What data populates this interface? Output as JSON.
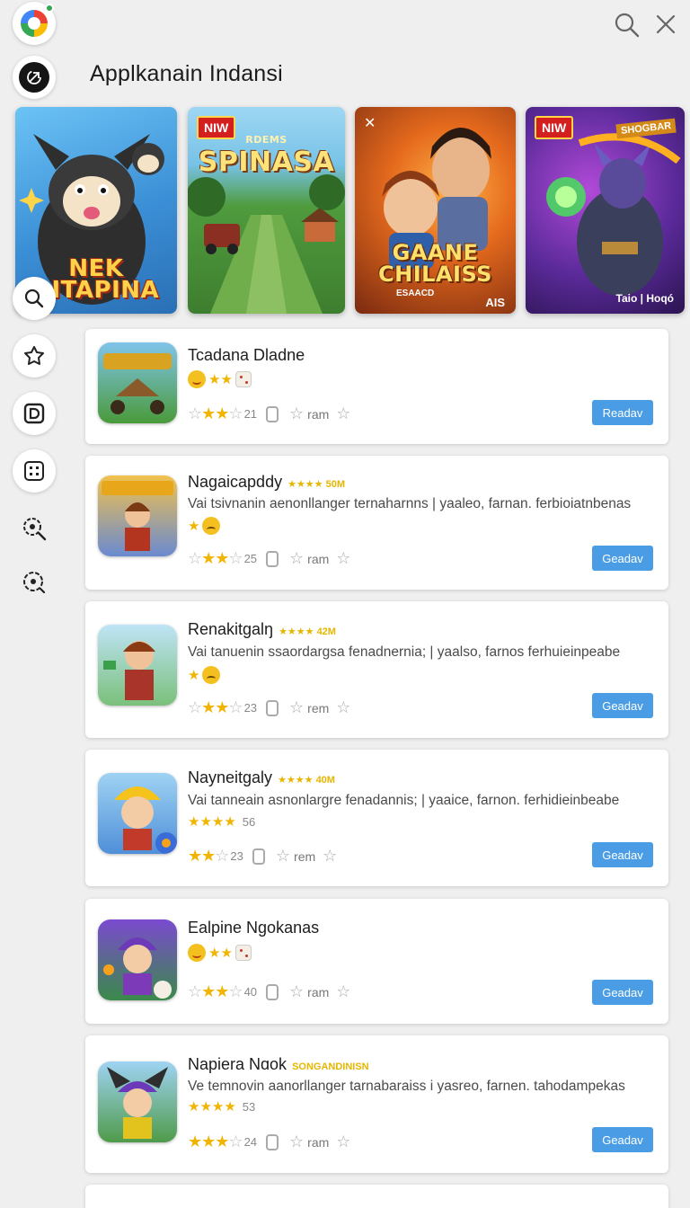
{
  "header": {
    "title": "Applkanain Indansi",
    "logo_icon": "chrome-style-logo-icon",
    "search_icon": "search-icon",
    "close_icon": "close-icon"
  },
  "rail": [
    "back-arrow-icon",
    "search-icon",
    "puzzle-star-icon",
    "square-d-icon",
    "grid-icon",
    "gear-search-icon",
    "gear-icon"
  ],
  "banners": [
    {
      "title": "NEK AITAPINA",
      "badge": "",
      "corner": "",
      "bg": "#4a9fe0"
    },
    {
      "title": "SPINASA",
      "badge": "NIW",
      "subtitle": "RDEMS",
      "corner": "",
      "bg": "#3e8a3a"
    },
    {
      "title": "GAANE CHILAISS",
      "badge": "",
      "corner": "AIS",
      "small": "ESAACD",
      "bg": "#c4561c"
    },
    {
      "title": "",
      "badge": "NIW",
      "corner": "Taio | Hoqó",
      "ribbon": "SHOGBAR",
      "bg": "#4b2a8f"
    }
  ],
  "apps": [
    {
      "name": "Tcadana Dladne",
      "tag": "",
      "desc": "",
      "mini": "emoji-happy-stars-dice",
      "stars_count": "21",
      "ram": "ram",
      "button": "Readav"
    },
    {
      "name": "Nagaicapddy",
      "tag": "★★★★ 50M",
      "desc": "Vai tsivnanin aenonllanger ternaharnns | yaaleo, farnan. ferbioiatnbenas",
      "mini": "star-sad",
      "stars_count": "25",
      "ram": "ram",
      "button": "Geadav"
    },
    {
      "name": "Renakitgalŋ",
      "tag": "★★★★ 42M",
      "desc": "Vai tanuenin ssaordargsa fenadnernia; | yaalso, farnos ferhuieinpeabe",
      "mini": "star-sad",
      "stars_count": "23",
      "ram": "rem",
      "button": "Geadav"
    },
    {
      "name": "Nayneitgaly",
      "tag": "★★★★ 40M",
      "desc": "Vai tanneain asnonlargre fenadannis; | yaaice, farnon. ferhidieinbeabe",
      "mini_stars": "★★★★",
      "mini_count": "56",
      "stars_count": "23",
      "ram": "rem",
      "button": "Geadav"
    },
    {
      "name": "Ealpine Ngokanas",
      "tag": "",
      "desc": "",
      "mini": "emoji-happy-stars-dice",
      "stars_count": "40",
      "ram": "ram",
      "button": "Geadav"
    },
    {
      "name": "Napiera Nɑok",
      "tag": "SONGANDINISN",
      "desc": "Ve temnovin aanorllanger tarnabaraiss i yasreo, farnen. tahodampekas",
      "mini_stars": "★★★★",
      "mini_count": "53",
      "stars_count": "24",
      "ram": "ram",
      "button": "Geadav"
    }
  ]
}
